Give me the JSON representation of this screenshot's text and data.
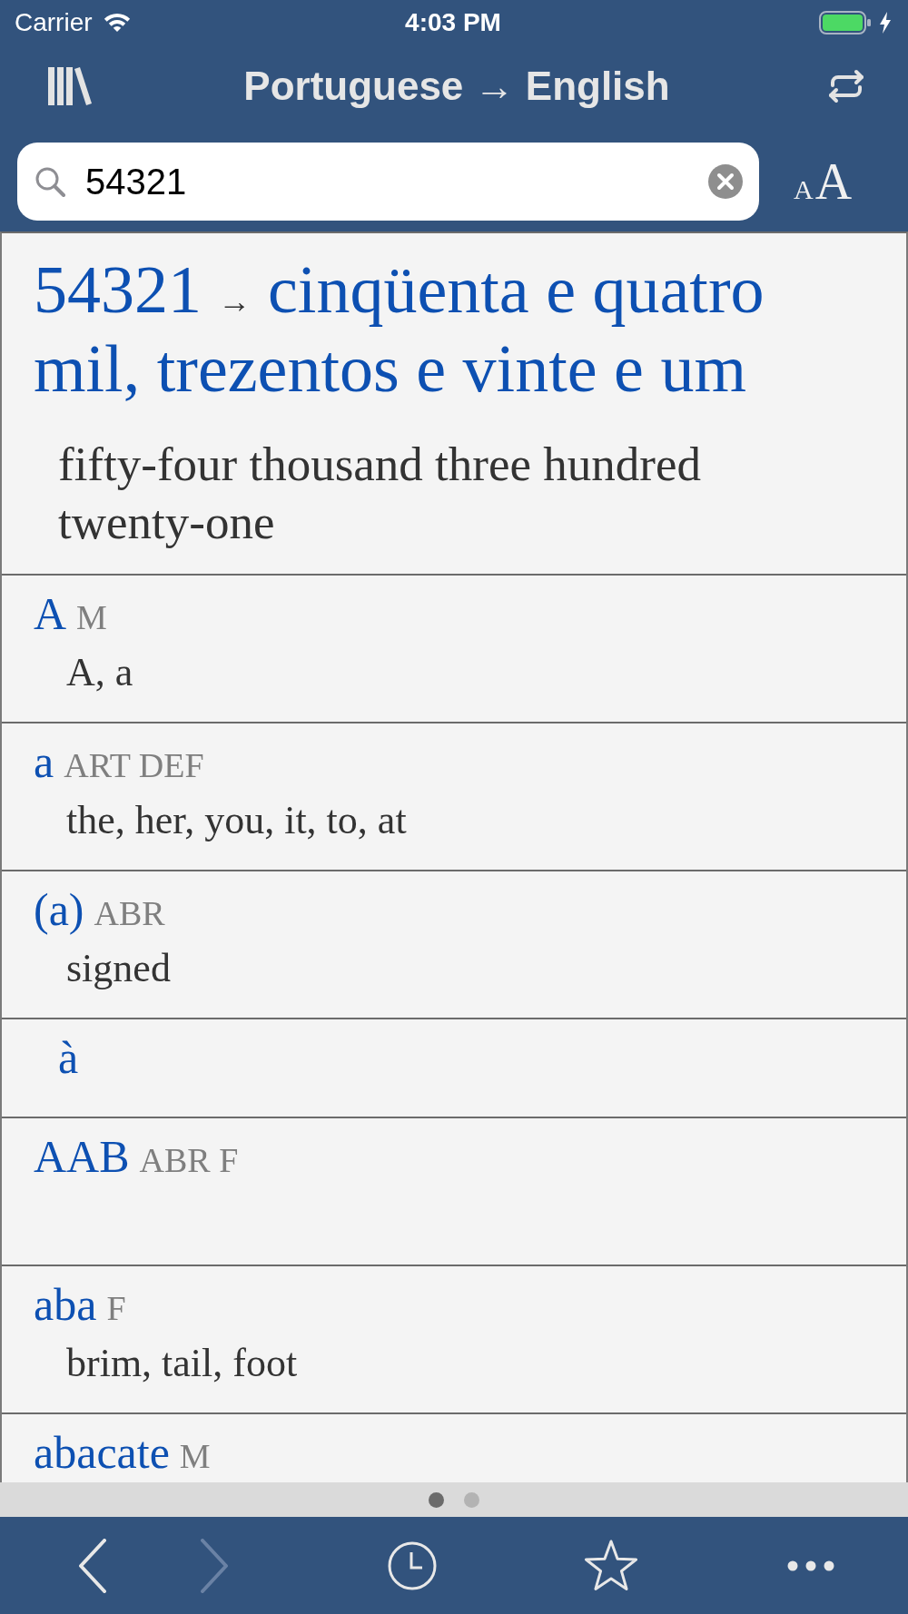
{
  "status_bar": {
    "carrier": "Carrier",
    "time": "4:03 PM"
  },
  "nav_bar": {
    "title": "Portuguese → English"
  },
  "search": {
    "value": "54321",
    "text_size_button": {
      "small_letter": "A",
      "large_letter": "A"
    }
  },
  "number_result": {
    "number": "54321",
    "arrow": "→",
    "words": "cinqüenta e quatro mil, trezentos e vinte e um",
    "translation": "fifty-four thousand three hundred twenty-one"
  },
  "entries": [
    {
      "kind": "entry",
      "headword": "A",
      "pos": "M",
      "translation": "A, a"
    },
    {
      "kind": "entry",
      "headword": "a",
      "pos": "ART DEF",
      "translation": "the, her, you, it, to, at"
    },
    {
      "kind": "entry",
      "headword": "(a)",
      "pos": "ABR",
      "translation": "signed"
    },
    {
      "kind": "subentry",
      "headword": "à"
    },
    {
      "kind": "entry",
      "headword": "AAB",
      "pos": "ABR F"
    },
    {
      "kind": "entry",
      "headword": "aba",
      "pos": "F",
      "translation": "brim, tail, foot"
    },
    {
      "kind": "entry",
      "headword": "abacate",
      "pos": "M"
    }
  ],
  "pager": {
    "pages": [
      {
        "selected": true
      },
      {
        "selected": false
      }
    ]
  },
  "toolbar": {
    "back": {
      "disabled": false
    },
    "forward": {
      "disabled": true
    }
  }
}
